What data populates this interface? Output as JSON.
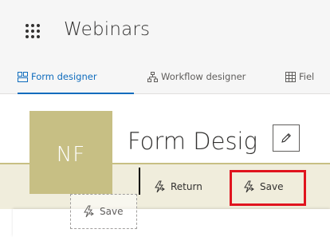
{
  "app": {
    "title": "Webinars",
    "menu_icon": "waffle-icon"
  },
  "tabs": [
    {
      "label": "Form designer",
      "icon": "form-designer-icon",
      "active": true
    },
    {
      "label": "Workflow designer",
      "icon": "workflow-icon",
      "active": false
    },
    {
      "label": "Fiel",
      "icon": "fields-icon",
      "active": false
    }
  ],
  "form": {
    "avatar_initials": "NF",
    "avatar_color": "#c7bf84",
    "title": "Form Desig",
    "edit_icon": "pencil-icon"
  },
  "commands": {
    "return_label": "Return",
    "save_label": "Save",
    "dragged_save_label": "Save",
    "icon": "flash-icon"
  },
  "colors": {
    "accent": "#0f6cbd",
    "highlight": "#e0141e",
    "command_bar": "#f0eddc"
  }
}
